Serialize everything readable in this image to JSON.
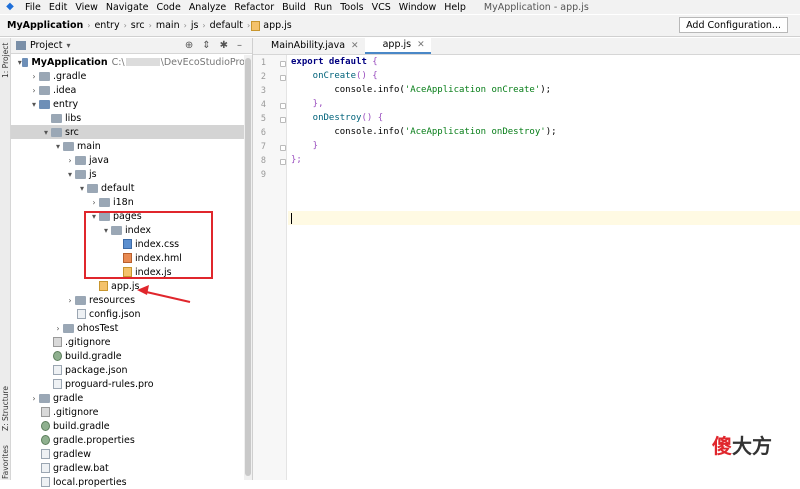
{
  "menubar": {
    "items": [
      "File",
      "Edit",
      "View",
      "Navigate",
      "Code",
      "Analyze",
      "Refactor",
      "Build",
      "Run",
      "Tools",
      "VCS",
      "Window",
      "Help"
    ],
    "window_title": "MyApplication - app.js"
  },
  "breadcrumb": [
    "MyApplication",
    "entry",
    "src",
    "main",
    "js",
    "default",
    "app.js"
  ],
  "add_configuration": "Add Configuration...",
  "side_tabs": {
    "project": "1: Project",
    "structure": "Z: Structure",
    "favorites": "Favorites"
  },
  "project_panel": {
    "title": "Project",
    "tree": [
      {
        "label": "MyApplication",
        "path_prefix": "C:\\",
        "path_suffix": "\\DevEcoStudioPro"
      },
      {
        "label": ".gradle"
      },
      {
        "label": ".idea"
      },
      {
        "label": "entry"
      },
      {
        "label": "libs"
      },
      {
        "label": "src"
      },
      {
        "label": "main"
      },
      {
        "label": "java"
      },
      {
        "label": "js"
      },
      {
        "label": "default"
      },
      {
        "label": "i18n"
      },
      {
        "label": "pages"
      },
      {
        "label": "index"
      },
      {
        "label": "index.css"
      },
      {
        "label": "index.hml"
      },
      {
        "label": "index.js"
      },
      {
        "label": "app.js"
      },
      {
        "label": "resources"
      },
      {
        "label": "config.json"
      },
      {
        "label": "ohosTest"
      },
      {
        "label": ".gitignore"
      },
      {
        "label": "build.gradle"
      },
      {
        "label": "package.json"
      },
      {
        "label": "proguard-rules.pro"
      },
      {
        "label": "gradle"
      },
      {
        "label": ".gitignore"
      },
      {
        "label": "build.gradle"
      },
      {
        "label": "gradle.properties"
      },
      {
        "label": "gradlew"
      },
      {
        "label": "gradlew.bat"
      },
      {
        "label": "local.properties"
      }
    ]
  },
  "editor": {
    "tabs": [
      {
        "label": "MainAbility.java",
        "active": false
      },
      {
        "label": "app.js",
        "active": true
      }
    ],
    "lines": [
      {
        "n": "1",
        "a": "export default",
        "b": " {"
      },
      {
        "n": "2",
        "a": "    onCreate",
        "b": "() {"
      },
      {
        "n": "3",
        "a": "        console.info(",
        "s": "'AceApplication onCreate'",
        "c": ");"
      },
      {
        "n": "4",
        "a": "    },"
      },
      {
        "n": "5",
        "a": "    onDestroy",
        "b": "() {"
      },
      {
        "n": "6",
        "a": "        console.info(",
        "s": "'AceApplication onDestroy'",
        "c": ");"
      },
      {
        "n": "7",
        "a": "    }"
      },
      {
        "n": "8",
        "a": "};"
      },
      {
        "n": "9",
        "a": ""
      }
    ]
  },
  "watermark": {
    "w1": "傻",
    "w2": "大方"
  }
}
